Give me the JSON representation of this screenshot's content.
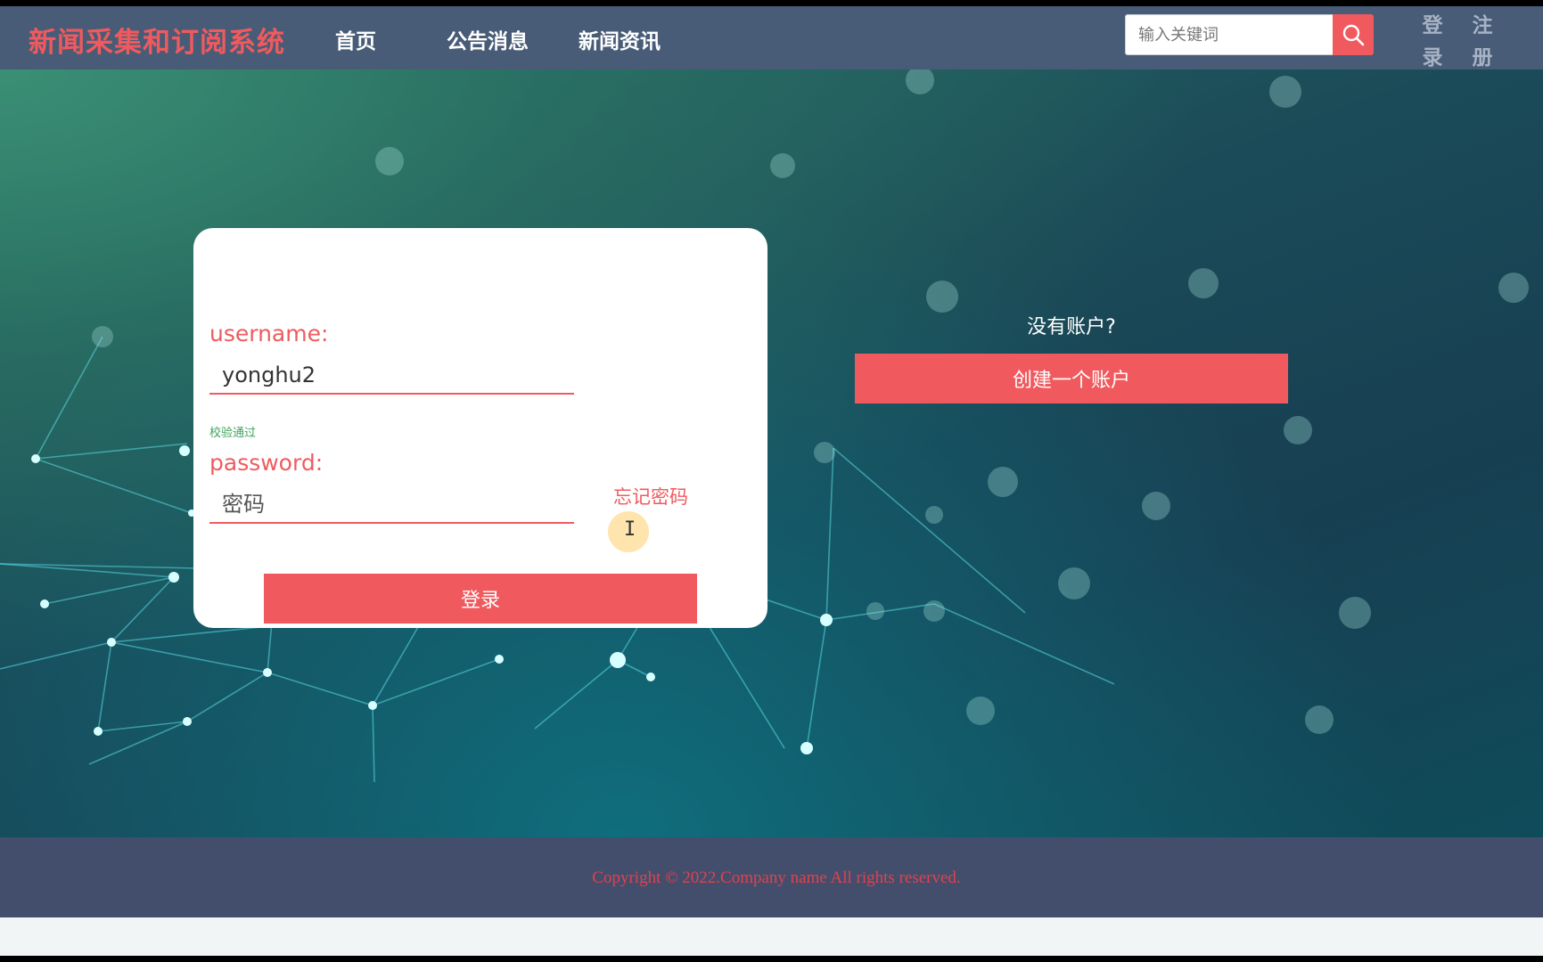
{
  "header": {
    "brand": "新闻采集和订阅系统",
    "nav": [
      {
        "label": "首页"
      },
      {
        "label": "公告消息"
      },
      {
        "label": "新闻资讯"
      }
    ],
    "search": {
      "placeholder": "输入关键词",
      "value": ""
    },
    "login_label": "登录",
    "login_chars": [
      "登",
      "录"
    ],
    "register_label": "注册",
    "register_chars": [
      "注",
      "册"
    ]
  },
  "login_form": {
    "username_label": "username:",
    "username_value": "yonghu2",
    "username_hint": "校验通过",
    "password_label": "password:",
    "password_placeholder": "密码",
    "forgot_label": "忘记密码",
    "submit_label": "登录"
  },
  "signup_panel": {
    "prompt": "没有账户?",
    "create_label": "创建一个账户"
  },
  "footer": {
    "copyright": "Copyright © 2022.Company name All rights reserved."
  },
  "colors": {
    "accent": "#f05a5e",
    "header_bg": "#485c77",
    "footer_bg": "#434e6c",
    "valid_hint": "#3fa45b"
  },
  "icons": {
    "search": "search-icon",
    "cursor": "text-cursor-icon"
  }
}
